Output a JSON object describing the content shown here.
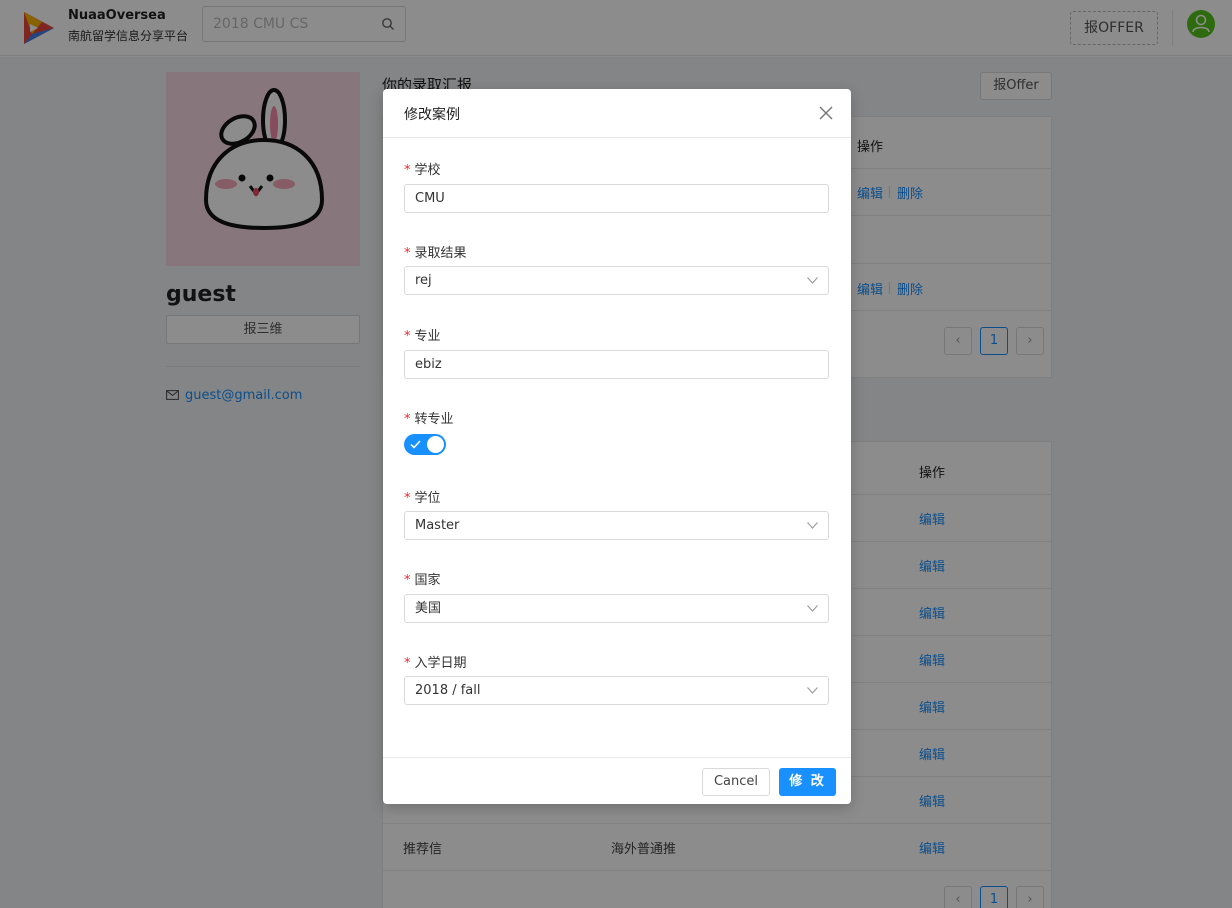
{
  "header": {
    "brand_name": "NuaaOversea",
    "brand_sub": "南航留学信息分享平台",
    "search_placeholder": "2018 CMU CS",
    "offer_button": "报OFFER"
  },
  "profile": {
    "username": "guest",
    "report_button": "报三维",
    "email": "guest@gmail.com"
  },
  "offers_section": {
    "title": "你的录取汇报",
    "add_button": "报Offer",
    "column_action": "操作",
    "edit_label": "编辑",
    "delete_label": "删除",
    "current_page": "1"
  },
  "profile_table": {
    "column_action": "操作",
    "edit_label": "编辑",
    "last_row": {
      "key": "推荐信",
      "value": "海外普通推"
    },
    "current_page": "1"
  },
  "modal": {
    "title": "修改案例",
    "required_mark": "*",
    "fields": {
      "school": {
        "label": "学校",
        "value": "CMU"
      },
      "result": {
        "label": "录取结果",
        "value": "rej"
      },
      "major": {
        "label": "专业",
        "value": "ebiz"
      },
      "transfer": {
        "label": "转专业",
        "checked": true
      },
      "degree": {
        "label": "学位",
        "value": "Master"
      },
      "country": {
        "label": "国家",
        "value": "美国"
      },
      "term": {
        "label": "入学日期",
        "value": "2018 / fall"
      }
    },
    "cancel_button": "Cancel",
    "submit_button": "修 改"
  },
  "colors": {
    "primary": "#1890ff",
    "required": "#f5222d",
    "avatar": "#52c41a"
  }
}
